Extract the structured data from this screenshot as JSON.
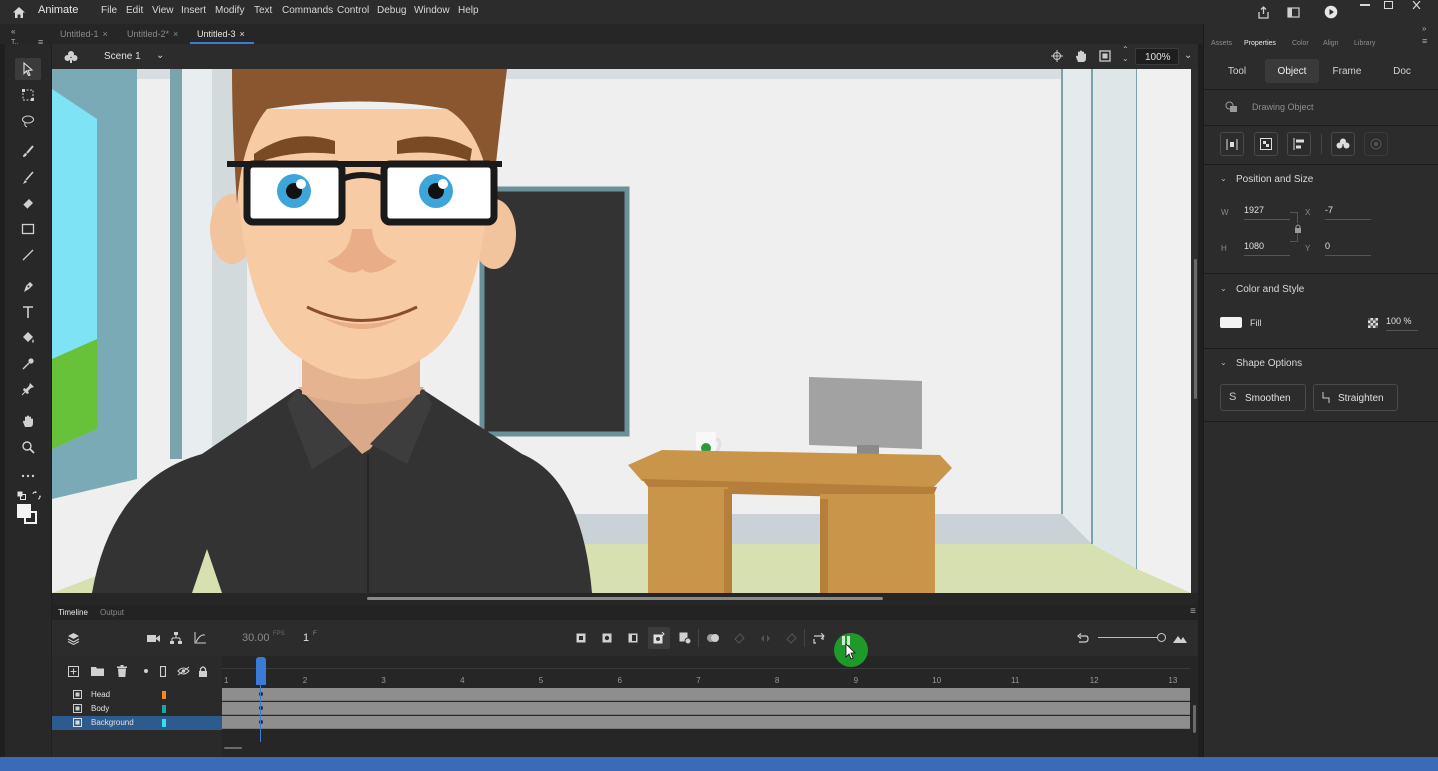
{
  "app": {
    "name": "Animate"
  },
  "menu": [
    "File",
    "Edit",
    "View",
    "Insert",
    "Modify",
    "Text",
    "Commands",
    "Control",
    "Debug",
    "Window",
    "Help"
  ],
  "doc_tabs": [
    {
      "label": "Untitled-1",
      "close": "×"
    },
    {
      "label": "Untitled-2*",
      "close": "×"
    },
    {
      "label": "Untitled-3",
      "close": "×"
    }
  ],
  "toolbar_header": "T..",
  "scene": {
    "name": "Scene 1",
    "zoom": "100%"
  },
  "timeline": {
    "tabs": [
      "Timeline",
      "Output"
    ],
    "fps": "30.00",
    "fps_unit": "FPS",
    "frame": "1",
    "frame_unit": "F",
    "layers": [
      {
        "name": "Head",
        "color": "#f08a1c"
      },
      {
        "name": "Body",
        "color": "#19a6a6"
      },
      {
        "name": "Background",
        "color": "#33e0f0"
      }
    ],
    "ruler": [
      "1",
      "2",
      "3",
      "4",
      "5",
      "6",
      "7",
      "8",
      "9",
      "10",
      "11",
      "12",
      "13"
    ]
  },
  "properties": {
    "panel_tabs": [
      "Assets",
      "Properties",
      "Color",
      "Align",
      "Library"
    ],
    "sub_tabs": [
      "Tool",
      "Object",
      "Frame",
      "Doc"
    ],
    "object_type": "Drawing Object",
    "position_size": {
      "title": "Position and Size",
      "w_label": "W",
      "w": "1927",
      "h_label": "H",
      "h": "1080",
      "x_label": "X",
      "x": "-7",
      "y_label": "Y",
      "y": "0"
    },
    "color_style": {
      "title": "Color and Style",
      "fill_label": "Fill",
      "opacity": "100 %"
    },
    "shape_options": {
      "title": "Shape Options",
      "smoothen": "Smoothen",
      "straighten": "Straighten"
    }
  },
  "colors": {
    "accent": "#2d5b8d",
    "playhead": "#3a7bd5",
    "play_button": "#1e9a2a"
  }
}
